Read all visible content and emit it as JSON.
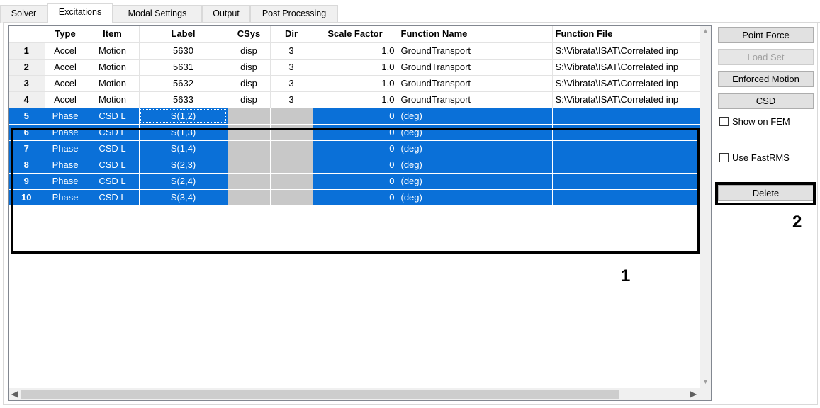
{
  "tabs": [
    {
      "label": "Solver"
    },
    {
      "label": "Excitations"
    },
    {
      "label": "Modal Settings"
    },
    {
      "label": "Output"
    },
    {
      "label": "Post Processing"
    }
  ],
  "active_tab": "Excitations",
  "grid": {
    "headers": [
      "",
      "Type",
      "Item",
      "Label",
      "CSys",
      "Dir",
      "Scale Factor",
      "Function Name",
      "Function File"
    ],
    "rows": [
      {
        "num": "1",
        "type": "Accel",
        "item": "Motion",
        "label": "5630",
        "csys": "disp",
        "dir": "3",
        "scale": "1.0",
        "fname": "GroundTransport",
        "ffile": "S:\\Vibrata\\ISAT\\Correlated inp",
        "selected": false
      },
      {
        "num": "2",
        "type": "Accel",
        "item": "Motion",
        "label": "5631",
        "csys": "disp",
        "dir": "3",
        "scale": "1.0",
        "fname": "GroundTransport",
        "ffile": "S:\\Vibrata\\ISAT\\Correlated inp",
        "selected": false
      },
      {
        "num": "3",
        "type": "Accel",
        "item": "Motion",
        "label": "5632",
        "csys": "disp",
        "dir": "3",
        "scale": "1.0",
        "fname": "GroundTransport",
        "ffile": "S:\\Vibrata\\ISAT\\Correlated inp",
        "selected": false
      },
      {
        "num": "4",
        "type": "Accel",
        "item": "Motion",
        "label": "5633",
        "csys": "disp",
        "dir": "3",
        "scale": "1.0",
        "fname": "GroundTransport",
        "ffile": "S:\\Vibrata\\ISAT\\Correlated inp",
        "selected": false
      },
      {
        "num": "5",
        "type": "Phase",
        "item": "CSD L",
        "label": "S(1,2)",
        "csys": "",
        "dir": "",
        "scale": "0",
        "fname": "(deg)",
        "ffile": "",
        "selected": true
      },
      {
        "num": "6",
        "type": "Phase",
        "item": "CSD L",
        "label": "S(1,3)",
        "csys": "",
        "dir": "",
        "scale": "0",
        "fname": "(deg)",
        "ffile": "",
        "selected": true
      },
      {
        "num": "7",
        "type": "Phase",
        "item": "CSD L",
        "label": "S(1,4)",
        "csys": "",
        "dir": "",
        "scale": "0",
        "fname": "(deg)",
        "ffile": "",
        "selected": true
      },
      {
        "num": "8",
        "type": "Phase",
        "item": "CSD L",
        "label": "S(2,3)",
        "csys": "",
        "dir": "",
        "scale": "0",
        "fname": "(deg)",
        "ffile": "",
        "selected": true
      },
      {
        "num": "9",
        "type": "Phase",
        "item": "CSD L",
        "label": "S(2,4)",
        "csys": "",
        "dir": "",
        "scale": "0",
        "fname": "(deg)",
        "ffile": "",
        "selected": true
      },
      {
        "num": "10",
        "type": "Phase",
        "item": "CSD L",
        "label": "S(3,4)",
        "csys": "",
        "dir": "",
        "scale": "0",
        "fname": "(deg)",
        "ffile": "",
        "selected": true
      }
    ]
  },
  "buttons": {
    "point_force": "Point Force",
    "load_set": "Load Set",
    "enforced_motion": "Enforced Motion",
    "csd": "CSD",
    "delete": "Delete"
  },
  "checkboxes": {
    "show_on_fem": "Show on FEM",
    "use_fastrms": "Use FastRMS"
  },
  "annotations": {
    "one": "1",
    "two": "2"
  },
  "colors": {
    "selection": "#0a70d8",
    "disabled_cell": "#c8c8c8"
  },
  "icons": {
    "scroll_left": "◀",
    "scroll_right": "▶",
    "scroll_up": "▲",
    "scroll_down": "▼"
  }
}
